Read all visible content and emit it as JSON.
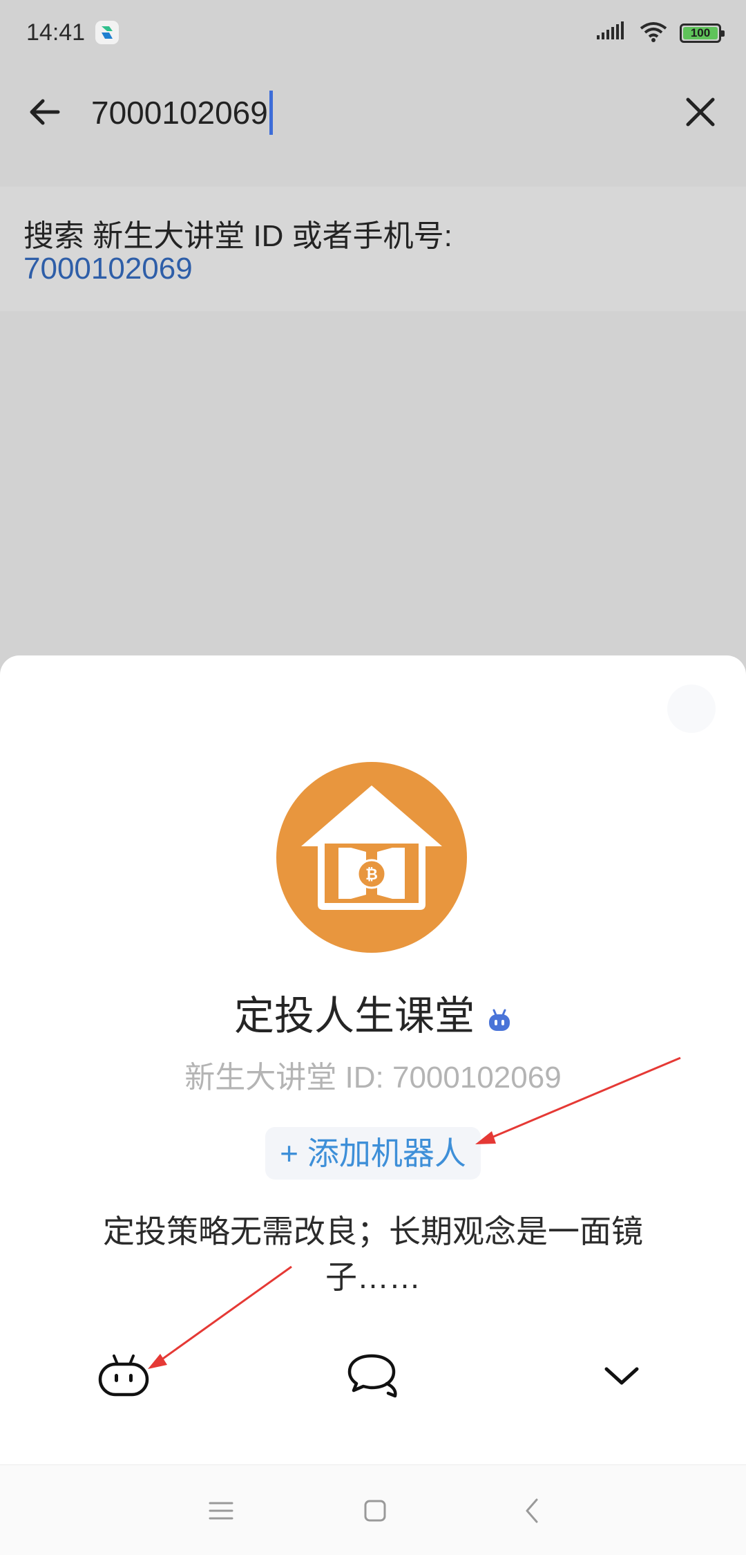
{
  "status_bar": {
    "time": "14:41",
    "battery": "100",
    "battery_level": 1.0,
    "icons": [
      "app-notification-icon",
      "signal-icon",
      "wifi-icon",
      "battery-icon"
    ]
  },
  "search": {
    "query": "7000102069",
    "icons": {
      "back": "arrow-left-icon",
      "clear": "close-icon"
    }
  },
  "result": {
    "prefix": "搜索 新生大讲堂 ID 或者手机号:",
    "id": "7000102069"
  },
  "bot": {
    "name": "定投人生课堂",
    "id_line": "新生大讲堂 ID: 7000102069",
    "add_button": "+ 添加机器人",
    "description": "定投策略无需改良；长期观念是一面镜子……",
    "avatar_icon": "house-bitcoin-logo"
  },
  "actions": {
    "icons": [
      "robot-icon",
      "chat-icon",
      "chevron-down-icon"
    ]
  },
  "nav": {
    "icons": [
      "menu-icon",
      "home-icon",
      "back-icon"
    ]
  },
  "colors": {
    "accent": "#3e8fd8",
    "link": "#2e5ea8",
    "avatar": "#e8963e",
    "annotation": "#e53935"
  }
}
